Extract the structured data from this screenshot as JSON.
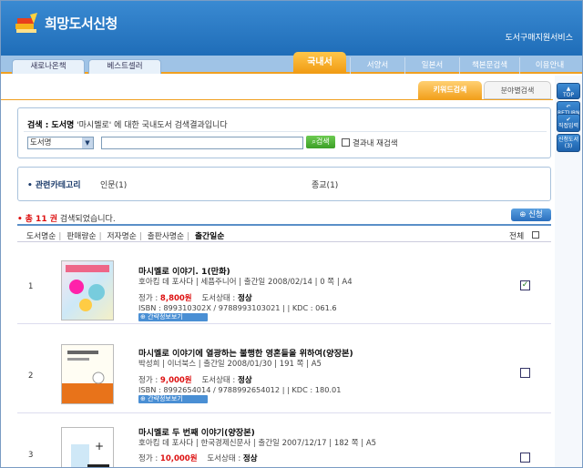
{
  "header": {
    "app_title": "희망도서신청",
    "service_title": "도서구매지원서비스"
  },
  "left_tabs": [
    {
      "label": "새로나온책"
    },
    {
      "label": "베스트셀러"
    }
  ],
  "right_tabs": {
    "active": "국내서",
    "items": [
      "서양서",
      "일본서",
      "책본문검색",
      "이용안내"
    ]
  },
  "right_bar": {
    "top": "TOP",
    "return": "RETURN",
    "direct": "직접입력",
    "apply": "신청도서(3)"
  },
  "sub_tabs": {
    "keyword": "키워드검색",
    "field": "분야별검색"
  },
  "search": {
    "message_prefix": "검색 : 도서명",
    "query": "'마시멜로'",
    "message_suffix": "에 대한 국내도서 검색결과입니다",
    "field_value": "도서명",
    "button": "검색",
    "rescan_label": "결과내 재검색"
  },
  "categories": {
    "title": "관련카테고리",
    "items": [
      "인문(1)",
      "종교(1)"
    ]
  },
  "results": {
    "total_count": "총 11 권",
    "total_suffix": "검색되었습니다.",
    "apply_button": "신청",
    "all_label": "전체"
  },
  "sort": {
    "items": [
      "도서명순",
      "판매량순",
      "저자명순",
      "출판사명순",
      "출간일순"
    ]
  },
  "books": [
    {
      "num": "1",
      "title": "마시멜로 이야기. 1(만화)",
      "meta": "호아킴 데 포사다 | 세픔주니어 | 출간일 2008/02/14 | 0 쪽 | A4",
      "price_label": "정가 :",
      "price": "8,800원",
      "status_label": "도서상태 :",
      "status": "정상",
      "isbn": "ISBN : 899310302X / 9788993103021 | | KDC : 061.6",
      "info": "간략정보보기",
      "checked": "✓"
    },
    {
      "num": "2",
      "title": "마시멜로 이야기에 열광하는 불행한 영혼들을 위하여(양장본)",
      "meta": "박성희 | 이너북스 | 출간일 2008/01/30 | 191 쪽 | A5",
      "price_label": "정가 :",
      "price": "9,000원",
      "status_label": "도서상태 :",
      "status": "정상",
      "isbn": "ISBN : 8992654014 / 9788992654012 | | KDC : 180.01",
      "info": "간략정보보기",
      "checked": ""
    },
    {
      "num": "3",
      "title": "마시멜로 두 번째 이야기(양장본)",
      "meta": "호아킴 데 포사다 | 한국경제신문사 | 출간일 2007/12/17 | 182 쪽 | A5",
      "price_label": "정가 :",
      "price": "10,000원",
      "status_label": "도서상태 :",
      "status": "정상",
      "isbn": "",
      "info": "",
      "checked": ""
    }
  ],
  "colors": {
    "header": "#1f6db8",
    "accent": "#f0a020",
    "price": "#dd1111"
  }
}
